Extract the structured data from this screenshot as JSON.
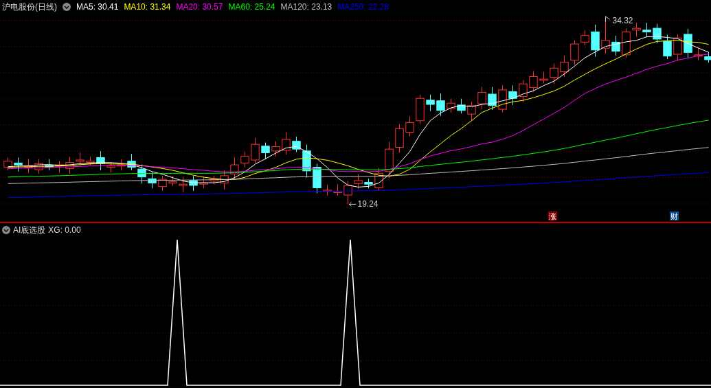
{
  "main_chart": {
    "title": "沪电股份(日线)",
    "moving_averages": [
      {
        "label": "MA5:",
        "value": "30.41",
        "color": "#ffffff"
      },
      {
        "label": "MA10:",
        "value": "31.34",
        "color": "#ffff00"
      },
      {
        "label": "MA20:",
        "value": "30.57",
        "color": "#ff00ff"
      },
      {
        "label": "MA60:",
        "value": "25.24",
        "color": "#00ff00"
      },
      {
        "label": "MA120:",
        "value": "23.13",
        "color": "#c0c0c0"
      },
      {
        "label": "MA250:",
        "value": "22.28",
        "color": "#0000ff"
      }
    ],
    "high_label": "34.32",
    "low_label": "19.24",
    "tags": [
      {
        "text": "涨",
        "color": "#8b0000"
      },
      {
        "text": "财",
        "color": "#0f4a8a"
      }
    ]
  },
  "indicator": {
    "title": "AI底选股",
    "reading": "XG: 0.00"
  }
}
